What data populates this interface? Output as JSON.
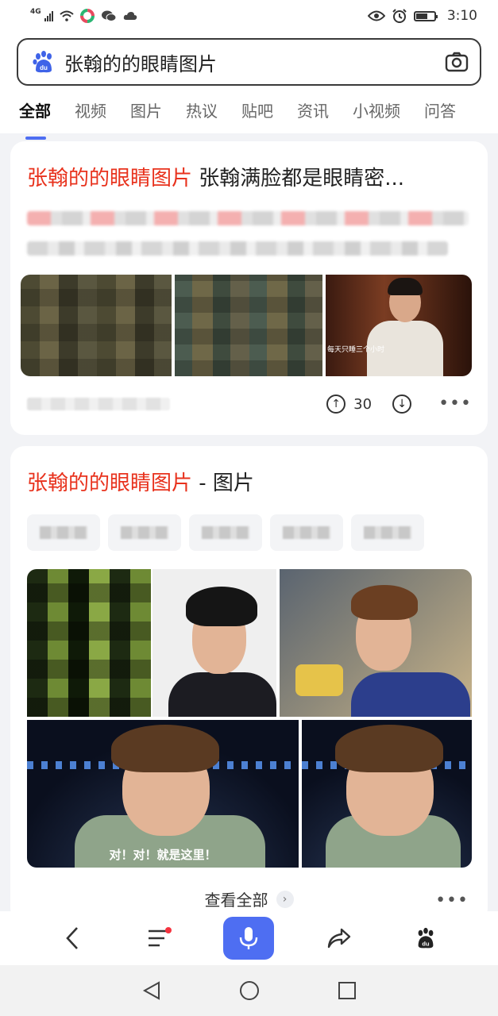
{
  "status_bar": {
    "network": "4G",
    "time": "3:10"
  },
  "search": {
    "query": "张翰的的眼睛图片"
  },
  "tabs": [
    {
      "label": "全部",
      "active": true
    },
    {
      "label": "视频"
    },
    {
      "label": "图片"
    },
    {
      "label": "热议"
    },
    {
      "label": "贴吧"
    },
    {
      "label": "资讯"
    },
    {
      "label": "小视频"
    },
    {
      "label": "问答"
    }
  ],
  "result1": {
    "title_highlight": "张翰的的眼睛图片",
    "title_rest": " 张翰满脸都是眼睛密...",
    "image_caption": "每天只睡三个小时",
    "upvotes": "30"
  },
  "result2": {
    "title_highlight": "张翰的的眼睛图片",
    "title_rest": " - 图片",
    "image_caption": "对！对！就是这里！",
    "see_all": "查看全部"
  },
  "colors": {
    "accent": "#4e6ef2",
    "highlight": "#e8321d"
  }
}
